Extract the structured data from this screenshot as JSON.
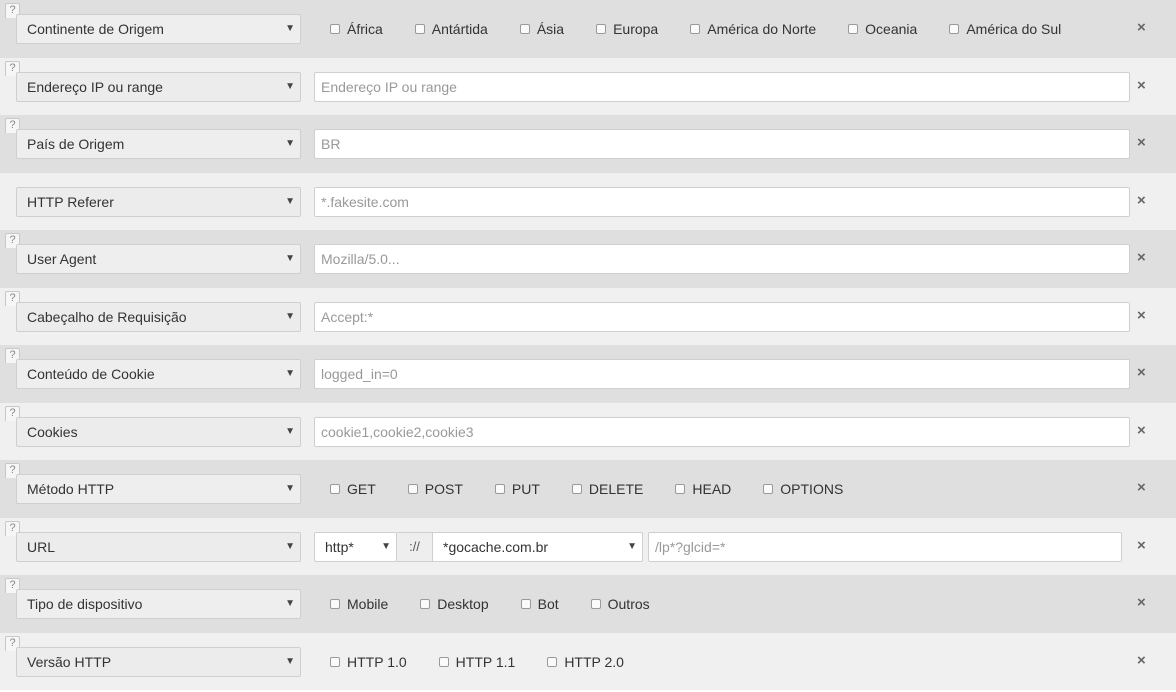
{
  "help_glyph": "?",
  "remove_glyph": "×",
  "caret_glyph": "▼",
  "rules": [
    {
      "type": "Continente de Origem",
      "checks": [
        "África",
        "Antártida",
        "Ásia",
        "Europa",
        "América do Norte",
        "Oceania",
        "América do Sul"
      ]
    },
    {
      "type": "Endereço IP ou range",
      "placeholder": "Endereço IP ou range"
    },
    {
      "type": "País de Origem",
      "placeholder": "BR"
    },
    {
      "type": "HTTP Referer",
      "placeholder": "*.fakesite.com"
    },
    {
      "type": "User Agent",
      "placeholder": "Mozilla/5.0..."
    },
    {
      "type": "Cabeçalho de Requisição",
      "placeholder": "Accept:*"
    },
    {
      "type": "Conteúdo de Cookie",
      "placeholder": "logged_in=0"
    },
    {
      "type": "Cookies",
      "placeholder": "cookie1,cookie2,cookie3"
    },
    {
      "type": "Método HTTP",
      "checks": [
        "GET",
        "POST",
        "PUT",
        "DELETE",
        "HEAD",
        "OPTIONS"
      ]
    },
    {
      "type": "URL",
      "url": {
        "protocol": "http*",
        "separator": "://",
        "host": "*gocache.com.br",
        "path_placeholder": "/lp*?glcid=*"
      }
    },
    {
      "type": "Tipo de dispositivo",
      "checks": [
        "Mobile",
        "Desktop",
        "Bot",
        "Outros"
      ]
    },
    {
      "type": "Versão HTTP",
      "checks": [
        "HTTP 1.0",
        "HTTP 1.1",
        "HTTP 2.0"
      ]
    }
  ]
}
